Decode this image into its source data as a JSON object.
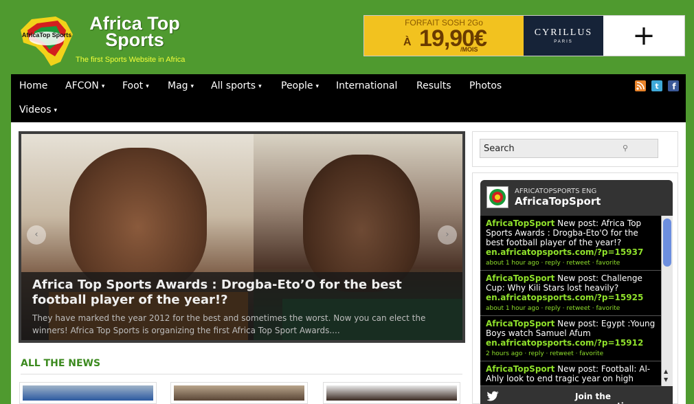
{
  "header": {
    "logo_badge_text": "AfricaTop Sports",
    "logo_title_line1": "Africa Top",
    "logo_title_line2": "Sports",
    "tagline": "The first Sports Website in Africa"
  },
  "ad": {
    "sosh_top": "FORFAIT SOSH 2Go",
    "sosh_price": "19,90€",
    "sosh_a": "À",
    "sosh_mois": "/MOIS",
    "cyrillus_name": "CYRILLUS",
    "cyrillus_sub": "PARIS",
    "plus": "+"
  },
  "nav": {
    "items": [
      {
        "label": "Home",
        "caret": ""
      },
      {
        "label": "AFCON",
        "caret": "▾"
      },
      {
        "label": "Foot",
        "caret": "▾"
      },
      {
        "label": "Mag",
        "caret": "▾"
      },
      {
        "label": "All sports",
        "caret": "▾"
      },
      {
        "label": "People",
        "caret": "▾"
      },
      {
        "label": "International",
        "caret": ""
      },
      {
        "label": "Results",
        "caret": ""
      },
      {
        "label": "Photos",
        "caret": ""
      },
      {
        "label": "Videos",
        "caret": "▾"
      }
    ],
    "social": [
      {
        "icon": "rss-icon",
        "color": "#e8832a"
      },
      {
        "icon": "twitter-icon",
        "color": "#3fa9d8"
      },
      {
        "icon": "facebook-icon",
        "color": "#3b5998"
      }
    ]
  },
  "slider": {
    "title": "Africa Top Sports Awards : Drogba-Eto’O for the best football player of the year!?",
    "description": "They have marked the year 2012 for the best and sometimes the worst. Now you can elect the winners! Africa Top Sports is organizing the first Africa Top Sport Awards....",
    "prev": "‹",
    "next": "›"
  },
  "news": {
    "section_title": "ALL THE NEWS"
  },
  "search": {
    "placeholder": "Search",
    "icon": "⚲"
  },
  "twitter": {
    "account_small": "AFRICATOPSPORTS ENG",
    "account_big": "AfricaTopSport",
    "tweets": [
      {
        "who": "AfricaTopSport",
        "text": " New post: Africa Top Sports Awards : Drogba-Eto'O for the best football player of the year!?",
        "link": "en.africatopsports.com/?p=15937",
        "meta": "about 1 hour ago · reply · retweet · favorite"
      },
      {
        "who": "AfricaTopSport",
        "text": " New post: Challenge Cup: Why Kili Stars lost heavily?",
        "link": "en.africatopsports.com/?p=15925",
        "meta": "about 1 hour ago · reply · retweet · favorite"
      },
      {
        "who": "AfricaTopSport",
        "text": " New post: Egypt :Young Boys watch Samuel Afum",
        "link": "en.africatopsports.com/?p=15912",
        "meta": "2 hours ago · reply · retweet · favorite"
      },
      {
        "who": "AfricaTopSport",
        "text": " New post: Football: Al-Ahly look to end tragic year on high",
        "link": "",
        "meta": ""
      }
    ],
    "join": "Join the conversation"
  }
}
